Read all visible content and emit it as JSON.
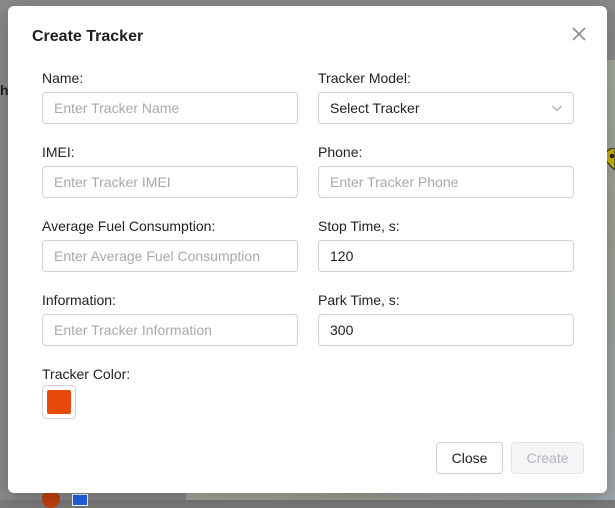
{
  "background": {
    "left_text": "h"
  },
  "modal": {
    "title": "Create Tracker",
    "fields": {
      "name": {
        "label": "Name:",
        "placeholder": "Enter Tracker Name",
        "value": ""
      },
      "model": {
        "label": "Tracker Model:",
        "placeholder": "Select Tracker",
        "value": ""
      },
      "imei": {
        "label": "IMEI:",
        "placeholder": "Enter Tracker IMEI",
        "value": ""
      },
      "phone": {
        "label": "Phone:",
        "placeholder": "Enter Tracker Phone",
        "value": ""
      },
      "fuel": {
        "label": "Average Fuel Consumption:",
        "placeholder": "Enter Average Fuel Consumption",
        "value": ""
      },
      "stop_time": {
        "label": "Stop Time, s:",
        "placeholder": "",
        "value": "120"
      },
      "information": {
        "label": "Information:",
        "placeholder": "Enter Tracker Information",
        "value": ""
      },
      "park_time": {
        "label": "Park Time, s:",
        "placeholder": "",
        "value": "300"
      },
      "color": {
        "label": "Tracker Color:",
        "value": "#e84a0c"
      }
    },
    "buttons": {
      "close": "Close",
      "create": "Create"
    }
  },
  "icons": {
    "close": "close-icon",
    "dropdown": "chevron-down-icon"
  }
}
